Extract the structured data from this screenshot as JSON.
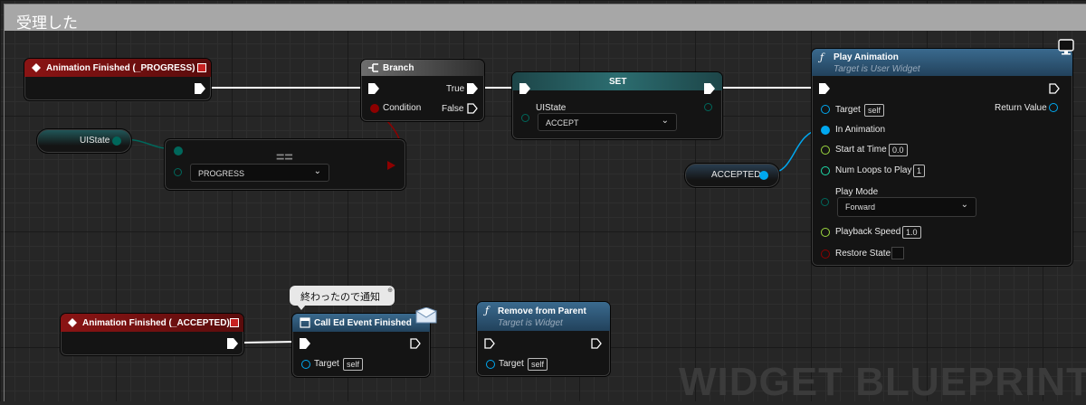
{
  "comment": {
    "title": "受理した",
    "watermark": "WIDGET BLUEPRINT"
  },
  "event_progress": {
    "title": "Animation Finished (_PROGRESS)"
  },
  "event_accepted": {
    "title": "Animation Finished (_ACCEPTED)"
  },
  "branch": {
    "title": "Branch",
    "condition": "Condition",
    "true_label": "True",
    "false_label": "False"
  },
  "set_node": {
    "title": "SET",
    "var_label": "UIState",
    "value": "ACCEPT"
  },
  "uistate_get": {
    "label": "UIState"
  },
  "equals_node": {
    "symbol": "==",
    "value": "PROGRESS"
  },
  "accepted_var": {
    "label": "ACCEPTED"
  },
  "play_anim": {
    "title": "Play Animation",
    "subtitle": "Target is User Widget",
    "target": "Target",
    "target_value": "self",
    "in_animation": "In Animation",
    "start_at_time": "Start at Time",
    "start_at_time_value": "0.0",
    "num_loops": "Num Loops to Play",
    "num_loops_value": "1",
    "play_mode": "Play Mode",
    "play_mode_value": "Forward",
    "playback_speed": "Playback Speed",
    "playback_speed_value": "1.0",
    "restore_state": "Restore State",
    "return_value": "Return Value"
  },
  "call_event": {
    "title": "Call Ed Event Finished",
    "bubble": "終わったので通知",
    "target": "Target",
    "target_value": "self"
  },
  "remove_parent": {
    "title": "Remove from Parent",
    "subtitle": "Target is Widget",
    "target": "Target",
    "target_value": "self"
  },
  "icons": [
    "event-diamond-icon",
    "branch-icon",
    "function-icon",
    "monitor-icon",
    "envelope-icon",
    "dispatcher-icon",
    "exec-pin-icon",
    "chevron-down-icon"
  ],
  "colors": {
    "event_header": "#8a1414",
    "function_header": "#355a78",
    "set_header": "#21575a",
    "exec": "#ffffff",
    "bool": "#8d0000",
    "enum": "#00675b",
    "object": "#00a8f0",
    "float": "#9cd83f",
    "int": "#1ed9a7"
  }
}
